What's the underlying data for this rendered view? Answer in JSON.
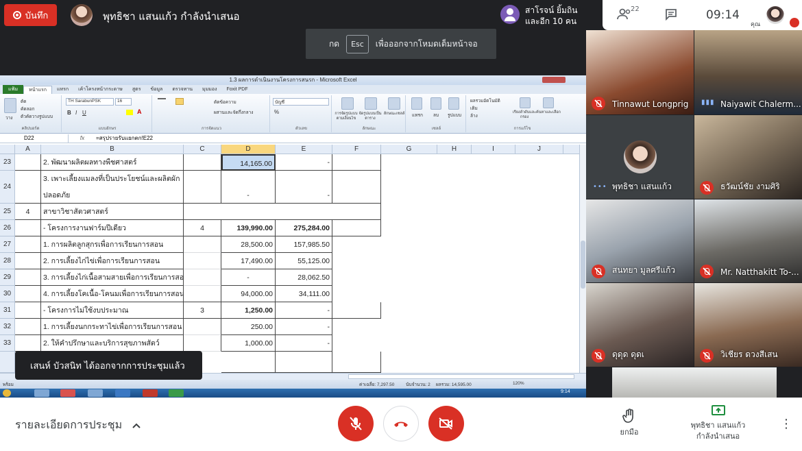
{
  "meet": {
    "record_label": "บันทึก",
    "presenter_text": "พุทธิชา แสนแก้ว กำลังนำเสนอ",
    "esc_prefix": "กด",
    "esc_key": "Esc",
    "esc_suffix": "เพื่อออกจากโหมดเต็มหน้าจอ",
    "joined_line1": "สาโรจน์ ยิ้มถิน",
    "joined_line2": "และอีก 10 คน",
    "participant_count": "22",
    "clock": "09:14",
    "me_label": "คุณ",
    "toast": "เสนห์ บัวสนิท ได้ออกจากการประชุมแล้ว",
    "details_label": "รายละเอียดการประชุม",
    "raise_hand_label": "ยกมือ",
    "presenting_line1": "พุทธิชา แสนแก้ว",
    "presenting_line2": "กำลังนำเสนอ",
    "colors": {
      "danger": "#d93025",
      "dark_bg": "#202124",
      "speaking": "#8ab4f8"
    }
  },
  "participants": [
    {
      "name": "Tinnawut Longprig",
      "muted": true
    },
    {
      "name": "Naiyawit Chalerm...",
      "muted": false,
      "speaking": true
    },
    {
      "name": "พุทธิชา แสนแก้ว",
      "muted": false,
      "speaking": true
    },
    {
      "name": "ธวัฒน์ชัย งามศิริ",
      "muted": true
    },
    {
      "name": "สนทยา มูลศรีแก้ว",
      "muted": true
    },
    {
      "name": "Mr. Natthakitt To-...",
      "muted": true
    },
    {
      "name": "ดุดุด ดุดเ",
      "muted": true
    },
    {
      "name": "วิเชียร ดวงสีเสน",
      "muted": true
    }
  ],
  "excel": {
    "title": "1.3 ผลการดำเนินงานโครงการสนรก - Microsoft Excel",
    "tabs": [
      "แฟ้ม",
      "หน้าแรก",
      "แทรก",
      "เค้าโครงหน้ากระดาษ",
      "สูตร",
      "ข้อมูล",
      "ตรวจทาน",
      "มุมมอง",
      "Foxit PDF"
    ],
    "font_name": "TH SarabunPSK",
    "font_size": "16",
    "number_format": "บัญชี",
    "ribbon_groups": [
      "คลิปบอร์ด",
      "แบบอักษร",
      "การจัดแนว",
      "ตัวเลข",
      "ลักษณะ",
      "เซลล์",
      "การแก้ไข"
    ],
    "ribbon_labels": {
      "paste": "วาง",
      "cut": "ตัด",
      "copy": "คัดลอก",
      "format_painter": "ตัวคัดวางรูปแบบ",
      "wrap_text": "ตัดข้อความ",
      "merge_center": "ผสานและจัดกึ่งกลาง",
      "conditional_formatting": "การจัดรูปแบบตามเงื่อนไข",
      "format_as_table": "จัดรูปแบบเป็นตาราง",
      "cell_styles": "ลักษณะเซลล์",
      "insert": "แทรก",
      "delete": "ลบ",
      "format": "รูปแบบ",
      "autosum": "ผลรวมอัตโนมัติ",
      "fill": "เติม",
      "clear": "ล้าง",
      "sort_filter": "เรียงลำดับและกรอง",
      "find_select": "ค้นหาและเลือก"
    },
    "name_box": "D22",
    "formula": "=สรุปรายรับแยกตก!E22",
    "columns": [
      "A",
      "B",
      "C",
      "D",
      "E",
      "F",
      "G",
      "H",
      "I",
      "J"
    ],
    "rows": [
      {
        "num": "23",
        "a": "",
        "b": "2. พัฒนาผลิตผลทางพืชศาสตร์",
        "c": "",
        "d": "14,165.00",
        "e": "-",
        "bold": false
      },
      {
        "num": "24",
        "a": "",
        "b": "3. เพาะเลี้ยงแมลงที่เป็นประโยชน์และผลิตผัก",
        "b2": "ปลอดภัย",
        "c": "",
        "d": "-",
        "e": "-",
        "bold": false
      },
      {
        "num": "25",
        "a": "4",
        "b": "สาขาวิชาสัตวศาสตร์",
        "c": "",
        "d": "",
        "e": "",
        "bold": false
      },
      {
        "num": "26",
        "a": "",
        "b": " - โครงการงานฟาร์มปีเดียว",
        "c": "4",
        "d": "139,990.00",
        "e": "275,284.00",
        "bold": true
      },
      {
        "num": "27",
        "a": "",
        "b": "1. การผลิตลูกสุกรเพื่อการเรียนการสอน",
        "c": "",
        "d": "28,500.00",
        "e": "157,985.50",
        "bold": false
      },
      {
        "num": "28",
        "a": "",
        "b": "2. การเลี้ยงไก่ไข่เพื่อการเรียนการสอน",
        "c": "",
        "d": "17,490.00",
        "e": "55,125.00",
        "bold": false
      },
      {
        "num": "29",
        "a": "",
        "b": "3. การเลี้ยงไก่เนื้อสามสายเพื่อการเรียนการสอน",
        "c": "",
        "d": "-",
        "e": "28,062.50",
        "bold": false
      },
      {
        "num": "30",
        "a": "",
        "b": "4. การเลี้ยงโคเนื้อ-โคนมเพื่อการเรียนการสอน",
        "c": "",
        "d": "94,000.00",
        "e": "34,111.00",
        "bold": false
      },
      {
        "num": "31",
        "a": "",
        "b": " - โครงการไม่ใช้งบประมาณ",
        "c": "3",
        "d": "1,250.00",
        "e": "-",
        "bold": true
      },
      {
        "num": "32",
        "a": "",
        "b": "1. การเลี้ยงนกกระทาไข่เพื่อการเรียนการสอน",
        "c": "",
        "d": "250.00",
        "e": "-",
        "bold": false
      },
      {
        "num": "33",
        "a": "",
        "b": "2. ให้คำปรึกษาและบริการสุขภาพสัตว์",
        "c": "",
        "d": "1,000.00",
        "e": "-",
        "bold": false
      }
    ],
    "status": {
      "ready": "พร้อม",
      "average": "ค่าเฉลี่ย: 7,297.50",
      "count": "นับจำนวน: 2",
      "sum": "ผลรวม: 14,595.00",
      "zoom": "120%"
    },
    "taskbar_time": "9:14"
  }
}
